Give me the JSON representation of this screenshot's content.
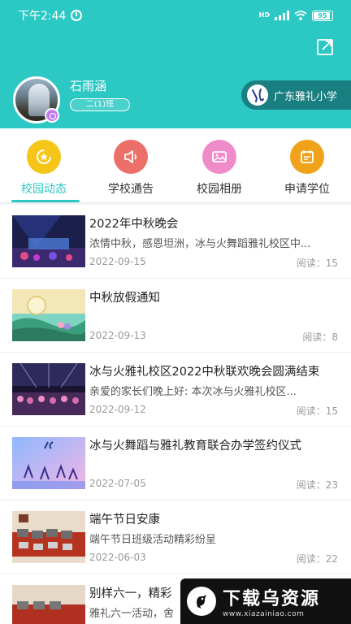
{
  "status_bar": {
    "time": "下午2:44",
    "network": "HD",
    "battery": "95"
  },
  "profile": {
    "name": "石雨涵",
    "class": "二(1)班"
  },
  "school": {
    "name": "广东雅礼小学"
  },
  "categories": [
    {
      "label": "校园动态",
      "icon": "star-icon",
      "color": "#f5c518",
      "active": true
    },
    {
      "label": "学校通告",
      "icon": "speaker-icon",
      "color": "#ec6f6a",
      "active": false
    },
    {
      "label": "校园相册",
      "icon": "photo-icon",
      "color": "#ef8bc8",
      "active": false
    },
    {
      "label": "申请学位",
      "icon": "calendar-icon",
      "color": "#f0a21a",
      "active": false
    }
  ],
  "news": [
    {
      "title": "2022年中秋晚会",
      "summary": "浓情中秋，感恩坦洲，冰与火舞蹈雅礼校区中...",
      "date": "2022-09-15",
      "reads": "阅读：15"
    },
    {
      "title": "中秋放假通知",
      "summary": "",
      "date": "2022-09-13",
      "reads": "阅读：8"
    },
    {
      "title": "冰与火雅礼校区2022中秋联欢晚会圆满结束",
      "summary": "亲爱的家长们晚上好: 本次冰与火雅礼校区...",
      "date": "2022-09-12",
      "reads": "阅读：15"
    },
    {
      "title": "冰与火舞蹈与雅礼教育联合办学签约仪式",
      "summary": "",
      "date": "2022-07-05",
      "reads": "阅读：23"
    },
    {
      "title": "端午节日安康",
      "summary": "端午节日班级活动精彩纷呈",
      "date": "2022-06-03",
      "reads": "阅读：22"
    },
    {
      "title": "别样六一，精彩",
      "summary": "雅礼六一活动，舍",
      "date": "",
      "reads": ""
    }
  ],
  "watermark": {
    "title": "下载乌资源",
    "url": "www.xiazainiao.com"
  },
  "colors": {
    "accent": "#2cc8c4",
    "school_pill": "#1a7f81"
  }
}
